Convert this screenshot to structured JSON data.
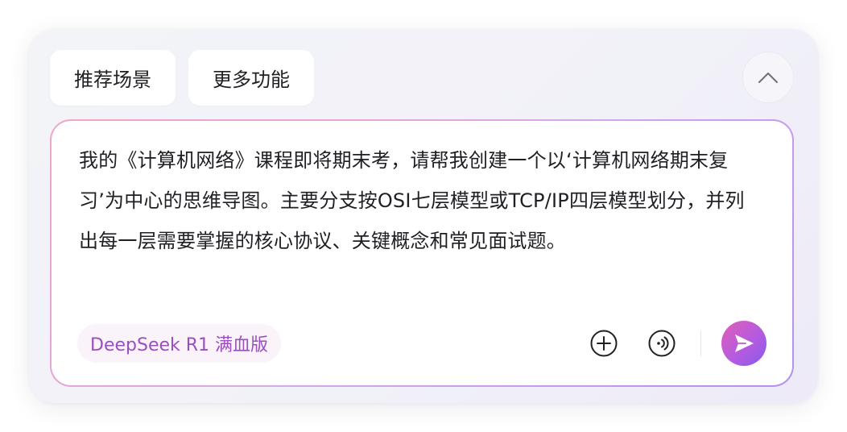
{
  "suggestions": {
    "chips": [
      {
        "label": "推荐场景"
      },
      {
        "label": "更多功能"
      }
    ]
  },
  "composer": {
    "prompt": "我的《计算机网络》课程即将期末考，请帮我创建一个以‘计算机网络期末复习’为中心的思维导图。主要分支按OSI七层模型或TCP/IP四层模型划分，并列出每一层需要掌握的核心协议、关键概念和常见面试题。",
    "model_label": "DeepSeek R1 满血版"
  },
  "icons": {
    "collapse": "chevron-up-icon",
    "add": "plus-circle-icon",
    "voice": "voice-icon",
    "send": "send-icon"
  },
  "colors": {
    "accent_start": "#e25fb6",
    "accent_end": "#8a5ae8",
    "model_text": "#9a4fc0"
  }
}
